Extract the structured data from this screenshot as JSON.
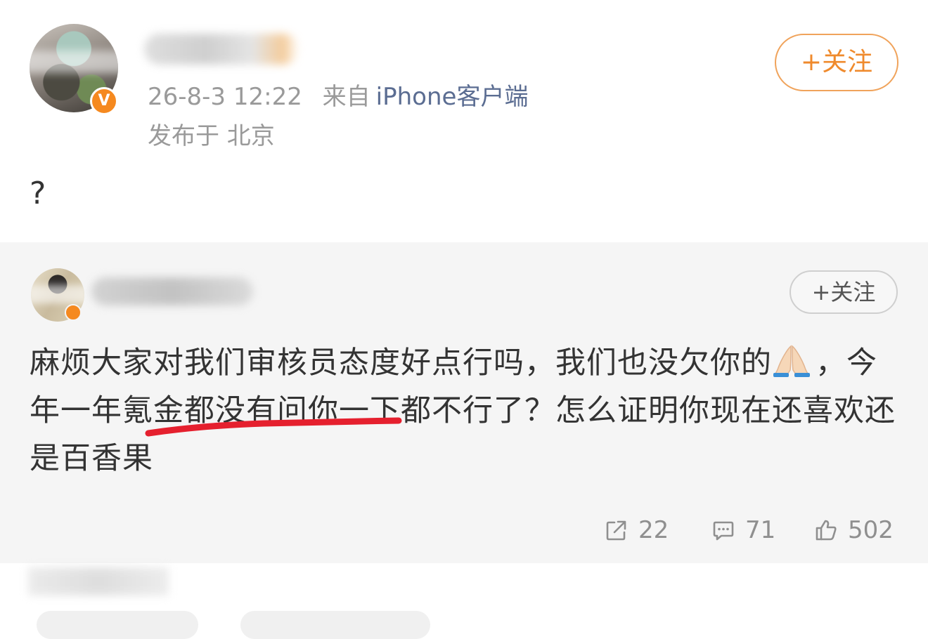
{
  "post": {
    "timestamp": "26-8-3 12:22",
    "source_prefix": "来自",
    "client": "iPhone客户端",
    "location": "发布于 北京",
    "follow_label": "+关注",
    "verified_badge": "V",
    "text": "?"
  },
  "comment": {
    "follow_label": "+关注",
    "text_part1": "麻烦大家对我们审核员态度好点行吗，我们也没欠你的",
    "emoji": "folded-hands-emoji",
    "text_part2": "，今年一年氪金都没有问你一下都不行了？怎么证明你现在还喜欢还是百香果",
    "highlight_color": "#e5202e"
  },
  "actions": {
    "share_count": "22",
    "comment_count": "71",
    "like_count": "502"
  },
  "colors": {
    "accent_orange": "#ef8a2c",
    "link_blue": "#5b6d92",
    "muted_gray": "#9a9a9a"
  }
}
